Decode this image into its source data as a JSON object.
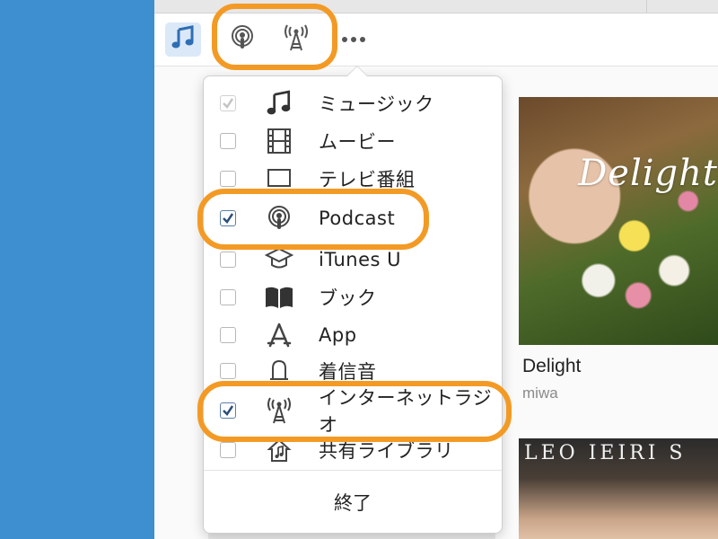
{
  "toolbar": {
    "buttons": [
      {
        "id": "music",
        "icon": "music-note-icon"
      },
      {
        "id": "podcast",
        "icon": "podcast-icon"
      },
      {
        "id": "internet-radio",
        "icon": "radio-tower-icon"
      },
      {
        "id": "more",
        "icon": "more-dots-icon"
      }
    ]
  },
  "menu": {
    "items": [
      {
        "label": "ミュージック",
        "icon": "music-note-icon",
        "checked": true,
        "disabled": true
      },
      {
        "label": "ムービー",
        "icon": "film-icon",
        "checked": false,
        "disabled": false
      },
      {
        "label": "テレビ番組",
        "icon": "tv-icon",
        "checked": false,
        "disabled": false
      },
      {
        "label": "Podcast",
        "icon": "podcast-icon",
        "checked": true,
        "disabled": false
      },
      {
        "label": "iTunes U",
        "icon": "graduation-cap-icon",
        "checked": false,
        "disabled": false
      },
      {
        "label": "ブック",
        "icon": "book-icon",
        "checked": false,
        "disabled": false
      },
      {
        "label": "App",
        "icon": "app-store-icon",
        "checked": false,
        "disabled": false
      },
      {
        "label": "着信音",
        "icon": "bell-icon",
        "checked": false,
        "disabled": false
      },
      {
        "label": "インターネットラジオ",
        "icon": "radio-tower-icon",
        "checked": true,
        "disabled": false
      },
      {
        "label": "共有ライブラリ",
        "icon": "home-music-icon",
        "checked": false,
        "disabled": false
      }
    ],
    "quit_label": "終了"
  },
  "album": {
    "cover_text": "Delight",
    "title": "Delight",
    "artist": "miwa"
  },
  "album2": {
    "cover_text": "LEO IEIRI S"
  },
  "colors": {
    "highlight": "#f39a25",
    "sidebar": "#3d8fcf",
    "accent": "#2e6db4",
    "checkbox_check": "#2a4f7a"
  }
}
